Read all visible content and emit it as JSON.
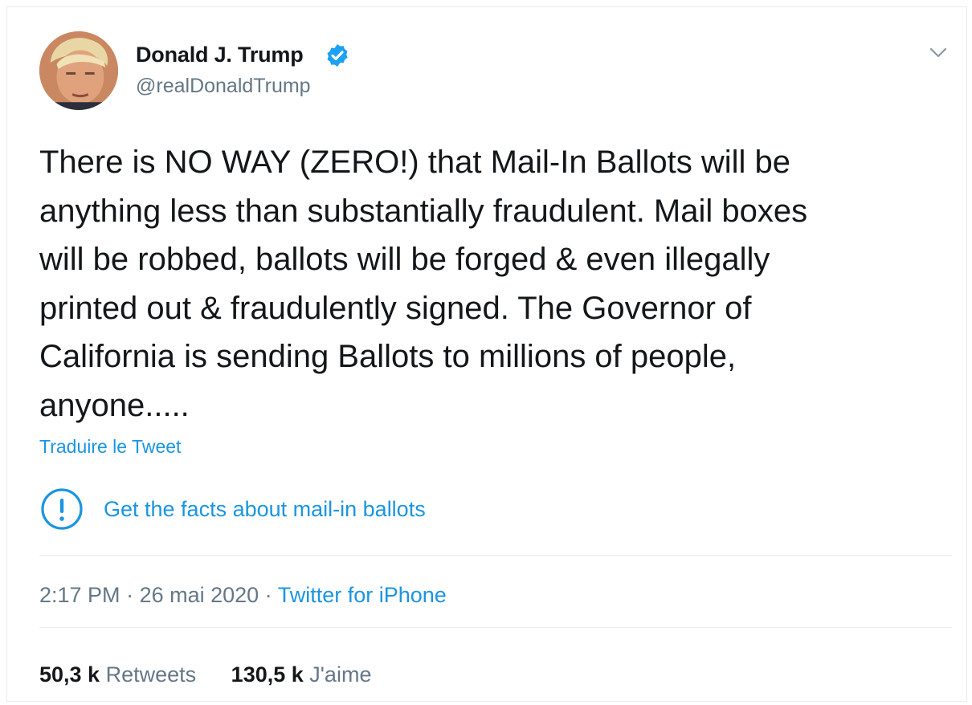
{
  "author": {
    "name": "Donald J. Trump",
    "handle": "@realDonaldTrump",
    "verified": true
  },
  "tweet": {
    "text": "There is NO WAY (ZERO!) that Mail-In Ballots will be\nanything less than substantially fraudulent. Mail boxes\nwill be robbed, ballots will be forged & even illegally\nprinted out & fraudulently signed. The Governor of\nCalifornia is sending Ballots to millions of people,\nanyone.....",
    "translate_label": "Traduire le Tweet"
  },
  "fact_check": {
    "label": "Get the facts about mail-in ballots",
    "icon": "exclamation-circle-icon"
  },
  "meta": {
    "time": "2:17 PM",
    "separator": " · ",
    "date": "26 mai 2020",
    "source": "Twitter for iPhone"
  },
  "stats": {
    "retweets_count": "50,3 k",
    "retweets_label": "Retweets",
    "likes_count": "130,5 k",
    "likes_label": "J'aime"
  },
  "colors": {
    "link": "#1b95e0",
    "secondary_text": "#657786",
    "primary_text": "#14171a",
    "divider": "#e6ecf0"
  }
}
